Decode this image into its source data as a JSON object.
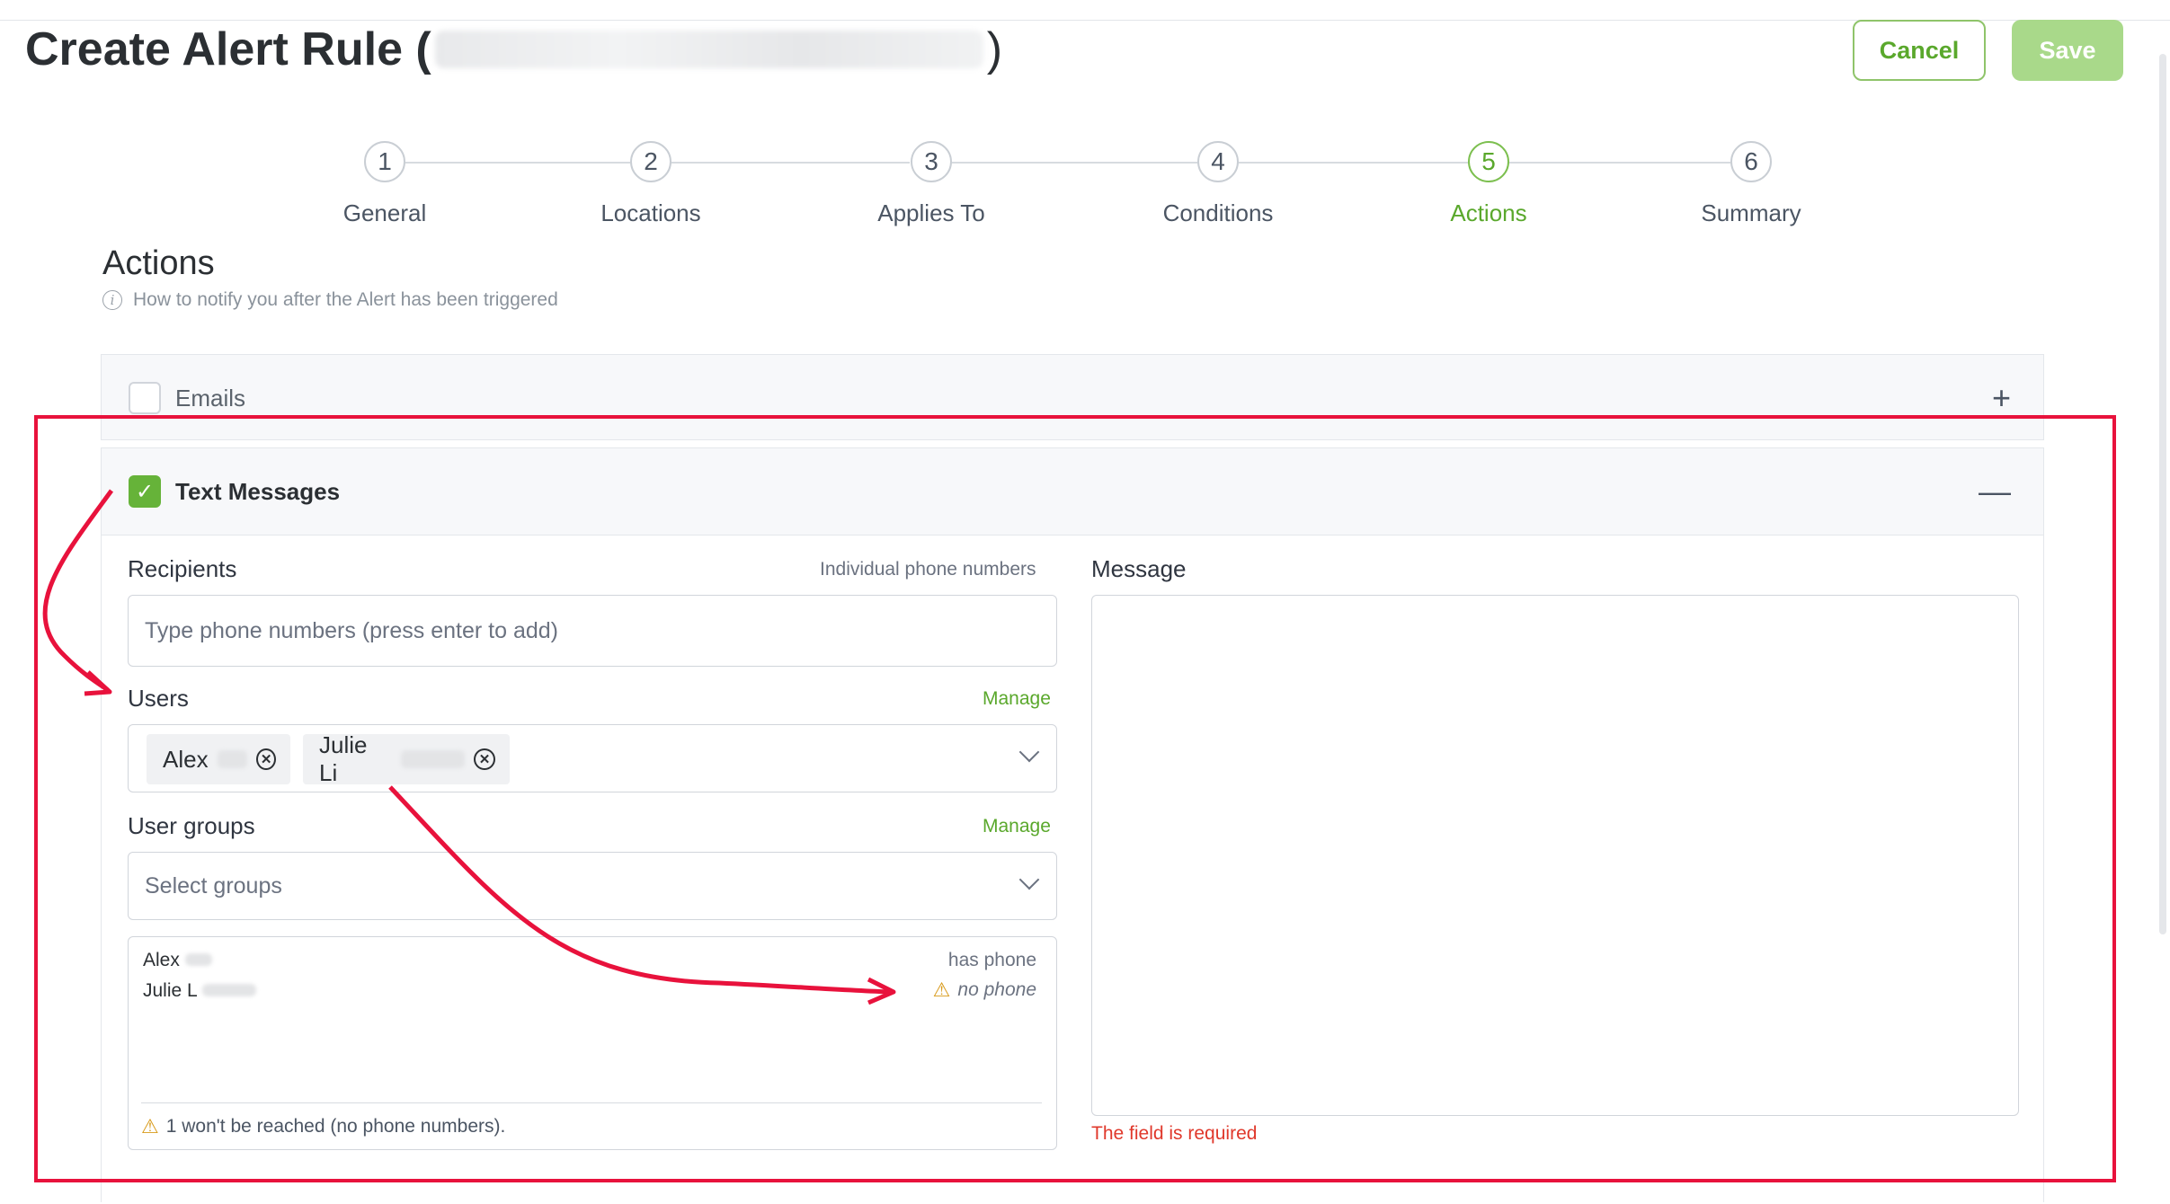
{
  "page": {
    "title": "Create Alert Rule (",
    "title_close": ")",
    "cancel_label": "Cancel",
    "save_label": "Save"
  },
  "steps": [
    {
      "number": "1",
      "label": "General"
    },
    {
      "number": "2",
      "label": "Locations"
    },
    {
      "number": "3",
      "label": "Applies To"
    },
    {
      "number": "4",
      "label": "Conditions"
    },
    {
      "number": "5",
      "label": "Actions",
      "active": true
    },
    {
      "number": "6",
      "label": "Summary"
    }
  ],
  "section": {
    "title": "Actions",
    "hint": "How to notify you after the Alert has been triggered"
  },
  "emails": {
    "label": "Emails",
    "checked": false
  },
  "text_messages": {
    "label": "Text Messages",
    "checked": true,
    "recipients_label": "Recipients",
    "recipients_hint": "Individual phone numbers",
    "recipients_placeholder": "Type phone numbers (press enter to add)",
    "users_label": "Users",
    "users_manage": "Manage",
    "users_chips": [
      "Alex",
      "Julie Li"
    ],
    "groups_label": "User groups",
    "groups_manage": "Manage",
    "groups_placeholder": "Select groups",
    "user_list": [
      {
        "name": "Alex",
        "status": "has phone"
      },
      {
        "name": "Julie L",
        "status": "no phone"
      }
    ],
    "reach_warning": "1 won't be reached (no phone numbers).",
    "message_label": "Message",
    "message_error": "The field is required"
  },
  "colors": {
    "accent": "#5aa82c",
    "highlight_box": "#e8123c",
    "error": "#e0382b"
  }
}
